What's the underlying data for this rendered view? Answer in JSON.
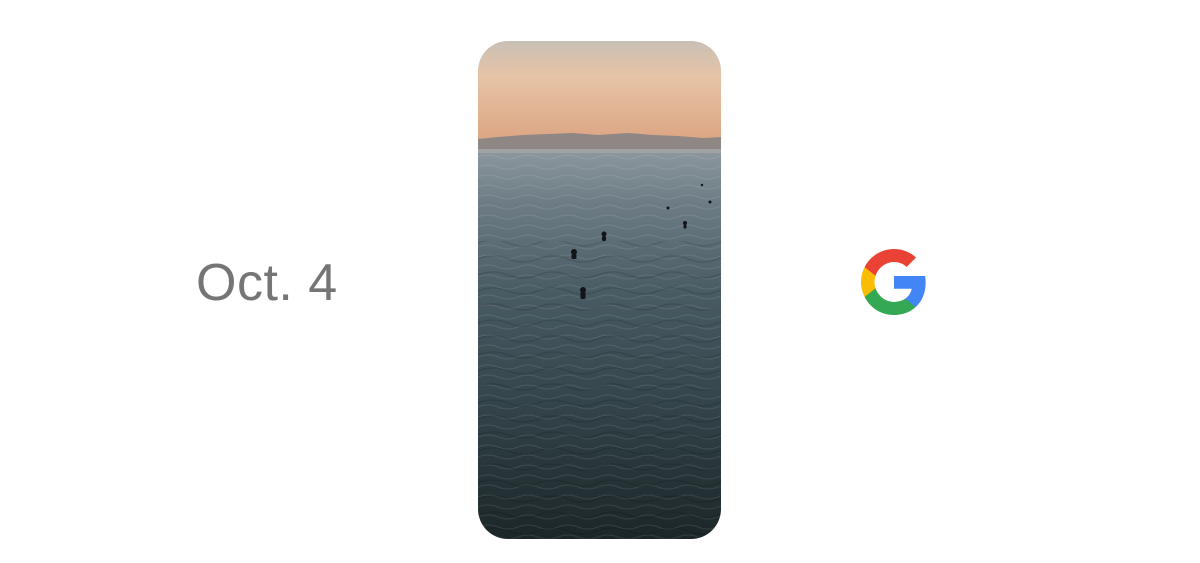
{
  "announcement": {
    "date_label": "Oct. 4"
  },
  "photo": {
    "scene": "ocean-sunset-swimmers",
    "colors": {
      "sky_top": "#e9c7a8",
      "sky_bottom": "#dba985",
      "mountains": "#8b8582",
      "water_top": "#7f8d96",
      "water_mid": "#3d5058",
      "water_bottom": "#1f2a2c"
    }
  },
  "brand": {
    "logo_icon": "google-g-icon",
    "colors": {
      "red": "#EA4335",
      "yellow": "#FBBC05",
      "green": "#34A853",
      "blue": "#4285F4"
    }
  }
}
